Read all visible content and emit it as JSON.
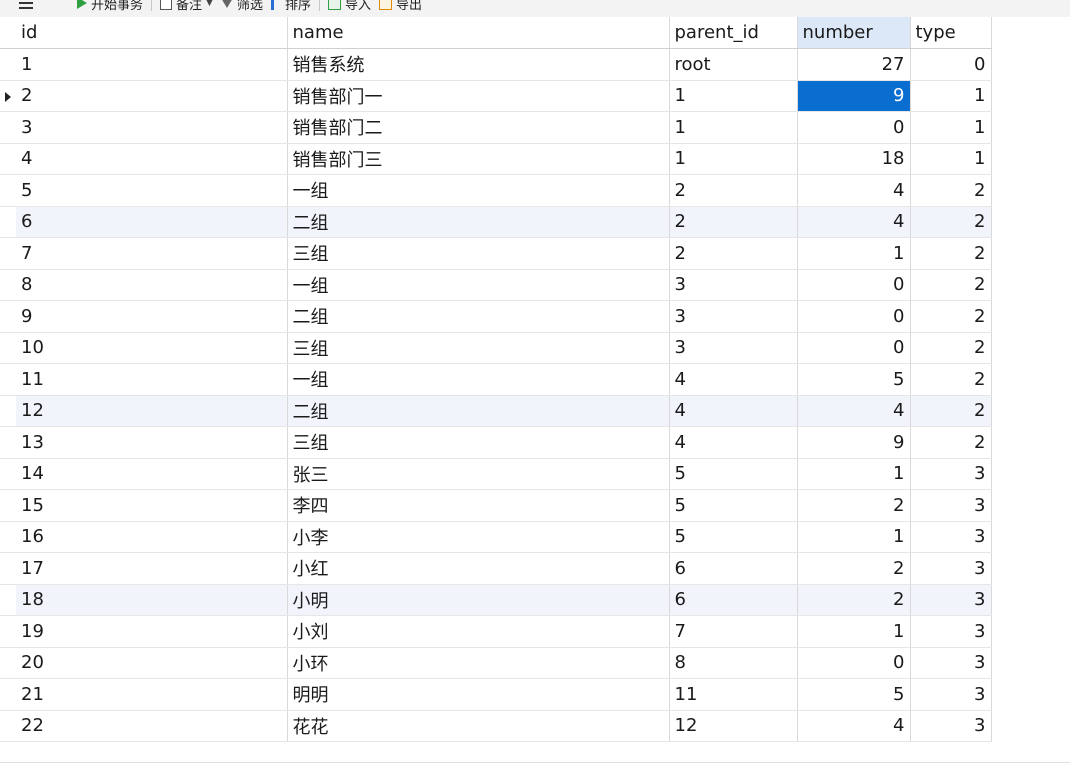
{
  "toolbar": {
    "begin_transaction": "开始事务",
    "note": "备注",
    "filter": "筛选",
    "sort": "排序",
    "import": "导入",
    "export": "导出"
  },
  "columns": [
    "id",
    "name",
    "parent_id",
    "number",
    "type"
  ],
  "selected": {
    "row": 1,
    "column": "number"
  },
  "rows": [
    {
      "id": "1",
      "name": "销售系统",
      "parent_id": "root",
      "number": "27",
      "type": "0"
    },
    {
      "id": "2",
      "name": "销售部门一",
      "parent_id": "1",
      "number": "9",
      "type": "1"
    },
    {
      "id": "3",
      "name": "销售部门二",
      "parent_id": "1",
      "number": "0",
      "type": "1"
    },
    {
      "id": "4",
      "name": "销售部门三",
      "parent_id": "1",
      "number": "18",
      "type": "1"
    },
    {
      "id": "5",
      "name": "一组",
      "parent_id": "2",
      "number": "4",
      "type": "2"
    },
    {
      "id": "6",
      "name": "二组",
      "parent_id": "2",
      "number": "4",
      "type": "2"
    },
    {
      "id": "7",
      "name": "三组",
      "parent_id": "2",
      "number": "1",
      "type": "2"
    },
    {
      "id": "8",
      "name": "一组",
      "parent_id": "3",
      "number": "0",
      "type": "2"
    },
    {
      "id": "9",
      "name": "二组",
      "parent_id": "3",
      "number": "0",
      "type": "2"
    },
    {
      "id": "10",
      "name": "三组",
      "parent_id": "3",
      "number": "0",
      "type": "2"
    },
    {
      "id": "11",
      "name": "一组",
      "parent_id": "4",
      "number": "5",
      "type": "2"
    },
    {
      "id": "12",
      "name": "二组",
      "parent_id": "4",
      "number": "4",
      "type": "2"
    },
    {
      "id": "13",
      "name": "三组",
      "parent_id": "4",
      "number": "9",
      "type": "2"
    },
    {
      "id": "14",
      "name": "张三",
      "parent_id": "5",
      "number": "1",
      "type": "3"
    },
    {
      "id": "15",
      "name": "李四",
      "parent_id": "5",
      "number": "2",
      "type": "3"
    },
    {
      "id": "16",
      "name": "小李",
      "parent_id": "5",
      "number": "1",
      "type": "3"
    },
    {
      "id": "17",
      "name": "小红",
      "parent_id": "6",
      "number": "2",
      "type": "3"
    },
    {
      "id": "18",
      "name": "小明",
      "parent_id": "6",
      "number": "2",
      "type": "3"
    },
    {
      "id": "19",
      "name": "小刘",
      "parent_id": "7",
      "number": "1",
      "type": "3"
    },
    {
      "id": "20",
      "name": "小环",
      "parent_id": "8",
      "number": "0",
      "type": "3"
    },
    {
      "id": "21",
      "name": "明明",
      "parent_id": "11",
      "number": "5",
      "type": "3"
    },
    {
      "id": "22",
      "name": "花花",
      "parent_id": "12",
      "number": "4",
      "type": "3"
    }
  ]
}
